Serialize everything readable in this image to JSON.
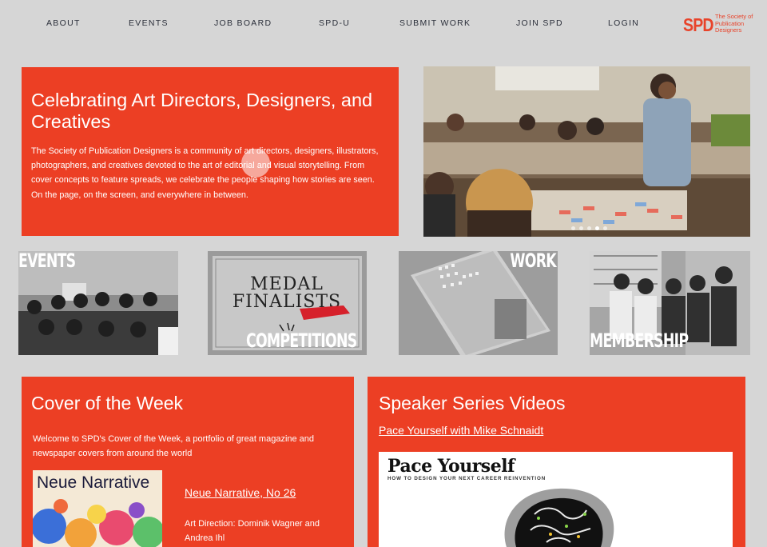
{
  "nav": {
    "items": [
      "ABOUT",
      "EVENTS",
      "JOB BOARD",
      "SPD-U",
      "SUBMIT WORK",
      "JOIN SPD",
      "LOGIN"
    ]
  },
  "logo": {
    "mark": "SPD",
    "text": "The Society of Publication Designers"
  },
  "hero": {
    "title": "Celebrating Art Directors, Designers, and Creatives",
    "text": "The Society of Publication Designers is a community of art directors, designers, illustrators, photographers, and creatives devoted to the art of editorial and visual storytelling. From cover concepts to feature spreads, we celebrate the people shaping how stories are seen. On the page, on the screen, and everywhere in between.",
    "carousel_count": 5,
    "carousel_active": 3
  },
  "tiles": [
    {
      "label": "EVENTS"
    },
    {
      "label": "COMPETITIONS",
      "medal_line1": "MEDAL",
      "medal_line2": "FINALISTS"
    },
    {
      "label": "WORK"
    },
    {
      "label": "MEMBERSHIP"
    }
  ],
  "cover": {
    "title": "Cover of the Week",
    "text": "Welcome to SPD's Cover of the Week, a portfolio of great magazine and newspaper covers from around the world",
    "magazine_name": "Neue Narrative",
    "link": "Neue Narrative, No 26",
    "credit": "Art Direction: Dominik Wagner and Andrea Ihl"
  },
  "speaker": {
    "title": "Speaker Series Videos",
    "link": "Pace Yourself with Mike Schnaidt",
    "video_title": "Pace Yourself",
    "video_subtitle": "HOW TO DESIGN YOUR NEXT CAREER REINVENTION"
  },
  "colors": {
    "accent": "#ec3f24",
    "background": "#d6d6d6",
    "nav_text": "#2b2f3a"
  }
}
